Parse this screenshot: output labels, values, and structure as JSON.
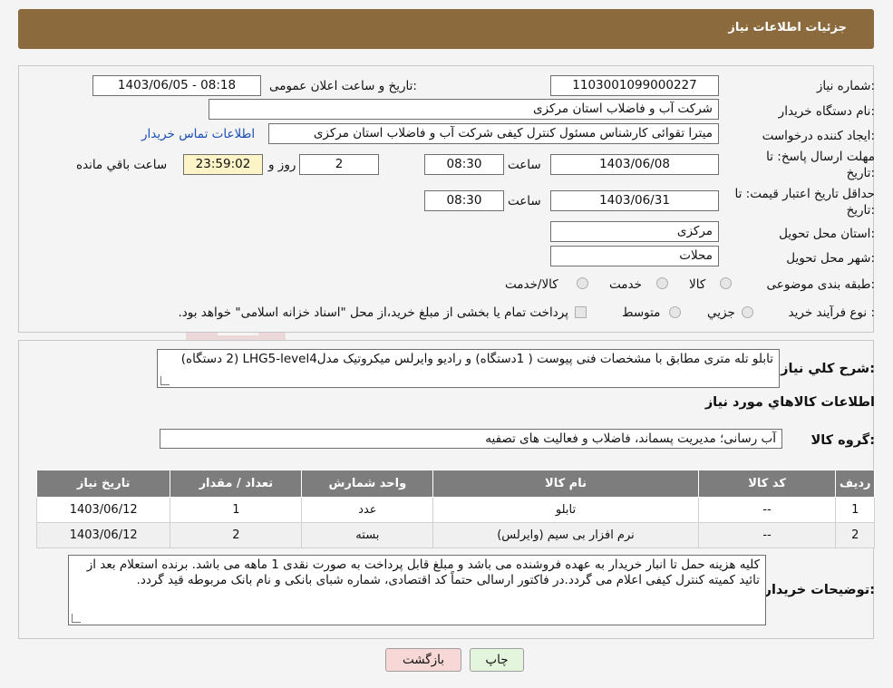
{
  "header": {
    "title": "جزئیات اطلاعات نیاز"
  },
  "form": {
    "need_number_label": "شماره نیاز:",
    "need_number": "1103001099000227",
    "announce_label": "تاریخ و ساعت اعلان عمومی:",
    "announce_value": "1403/06/05 - 08:18",
    "buyer_org_label": "نام دستگاه خریدار:",
    "buyer_org": "شرکت آب و فاضلاب استان مرکزی",
    "creator_label": "ایجاد کننده درخواست:",
    "creator": "میترا تقوائی کارشناس مسئول کنترل کیفی شرکت آب و فاضلاب استان مرکزی",
    "contact_link": "اطلاعات تماس خریدار",
    "reply_deadline_label_1": "مهلت ارسال پاسخ: تا",
    "reply_deadline_label_2": "تاریخ:",
    "reply_date": "1403/06/08",
    "time_label": "ساعت",
    "reply_time": "08:30",
    "days": "2",
    "days_label": "روز و",
    "remaining": "23:59:02",
    "remaining_label": "ساعت باقي مانده",
    "price_validity_label_1": "حداقل تاریخ اعتبار قیمت: تا",
    "price_validity_label_2": "تاریخ:",
    "validity_date": "1403/06/31",
    "validity_time": "08:30",
    "province_label": "استان محل تحویل:",
    "province": "مرکزی",
    "city_label": "شهر محل تحویل:",
    "city": "محلات",
    "category_label": "طبقه بندی موضوعی:",
    "category_options": [
      "کالا",
      "خدمت",
      "کالا/خدمت"
    ],
    "process_label": "نوع فرآیند خرید :",
    "process_options": [
      "جزیي",
      "متوسط"
    ],
    "process_note": "پرداخت تمام یا بخشی از مبلغ خرید،از محل \"اسناد خزانه اسلامی\" خواهد بود."
  },
  "description": {
    "label": "شرح کلي نياز:",
    "text": "تابلو تله متری مطابق با مشخصات فنی پیوست ( 1دستگاه) و رادیو وایرلس میکروتیک مدلLHG5-level4 (2 دستگاه)"
  },
  "goods_info_title": "اطلاعات کالاهاي مورد نياز",
  "goods_group": {
    "label": "گروه کالا:",
    "value": "آب رسانی؛ مدیریت پسماند، فاضلاب و فعالیت های تصفیه"
  },
  "table": {
    "headers": [
      "رديف",
      "کد کالا",
      "نام کالا",
      "واحد شمارش",
      "تعداد / مقدار",
      "تاریخ نیاز"
    ],
    "rows": [
      [
        "1",
        "--",
        "تابلو",
        "عدد",
        "1",
        "1403/06/12"
      ],
      [
        "2",
        "--",
        "نرم افزار بی سیم (وایرلس)",
        "بسته",
        "2",
        "1403/06/12"
      ]
    ]
  },
  "buyer_notes": {
    "label": "توضیحات خریدار:",
    "text": "کلیه هزینه حمل تا انبار خریدار به عهده فروشنده می باشد و مبلغ قابل پرداخت به صورت نقدی 1 ماهه می باشد. برنده استعلام بعد از تائید کمیته کنترل کیفی اعلام می گردد.در فاکتور ارسالی حتماً کد اقتصادی، شماره شبای بانکی و نام بانک مربوطه قید گردد."
  },
  "buttons": {
    "print": "چاپ",
    "back": "بازگشت"
  },
  "colors": {
    "header_bg": "#8b6a3e",
    "table_header_bg": "#7d7d7d",
    "back_button_bg": "#f8d7d7",
    "print_button_bg": "#e3f5dc"
  }
}
